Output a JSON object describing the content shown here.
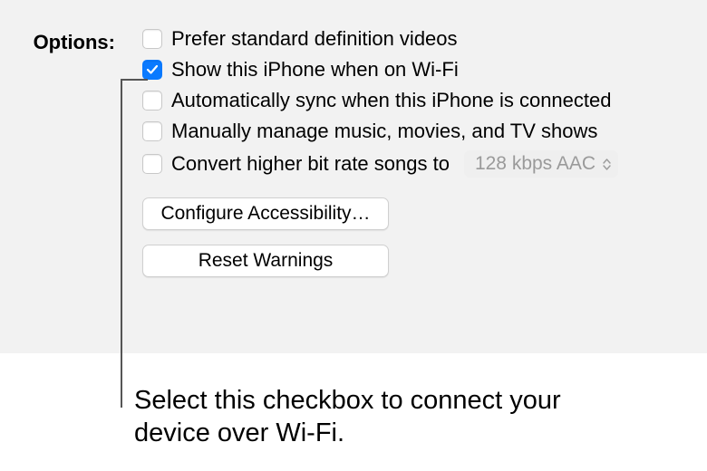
{
  "options_label": "Options:",
  "checkboxes": {
    "prefer_sd": {
      "label": "Prefer standard definition videos",
      "checked": false
    },
    "show_wifi": {
      "label": "Show this iPhone when on Wi-Fi",
      "checked": true
    },
    "auto_sync": {
      "label": "Automatically sync when this iPhone is connected",
      "checked": false
    },
    "manual_manage": {
      "label": "Manually manage music, movies, and TV shows",
      "checked": false
    },
    "convert_bitrate": {
      "label": "Convert higher bit rate songs to",
      "checked": false
    }
  },
  "bitrate_dropdown": {
    "value": "128 kbps AAC"
  },
  "buttons": {
    "configure_accessibility": "Configure Accessibility…",
    "reset_warnings": "Reset Warnings"
  },
  "caption": "Select this checkbox to connect your device over Wi-Fi."
}
